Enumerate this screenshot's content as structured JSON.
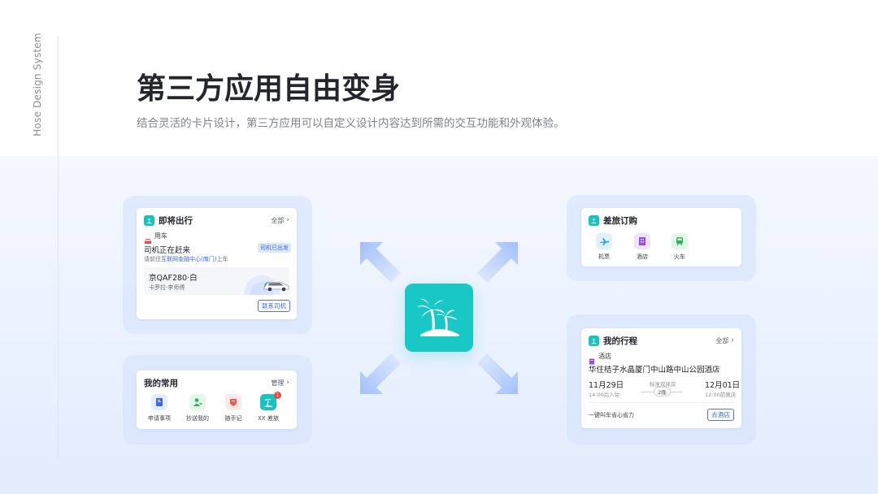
{
  "brand_vertical": "Hose Design System",
  "title": "第三方应用自由变身",
  "subtitle": "结合灵活的卡片设计，第三方应用可以自定义设计内容达到所需的交互功能和外观体验。",
  "colors": {
    "accent": "#17c2c0",
    "primary_blue": "#3a64f0",
    "badge_bg": "#dbe8ff",
    "badge_text": "#3f6cf0"
  },
  "trip_card": {
    "title": "即将出行",
    "more": "全部",
    "section": "用车",
    "status": "司机正在赶来",
    "badge": "司机已出发",
    "pickup_prefix": "请前往",
    "pickup_place": "互联网金融中心(南门)",
    "pickup_suffix": "上车",
    "plate": "京QAF280·白",
    "driver": "卡罗拉·李师傅",
    "contact_button": "联系司机"
  },
  "favorites_card": {
    "title": "我的常用",
    "more": "管理",
    "items": [
      {
        "label": "申请事项",
        "icon": "document-icon"
      },
      {
        "label": "抄送我的",
        "icon": "user-forward-icon"
      },
      {
        "label": "随手记",
        "icon": "note-icon"
      },
      {
        "label": "XX 差旅",
        "icon": "palm-tree-icon"
      }
    ],
    "notification_count": "1"
  },
  "booking_card": {
    "title": "差旅订购",
    "items": [
      {
        "label": "机票",
        "icon": "plane-icon"
      },
      {
        "label": "酒店",
        "icon": "hotel-icon"
      },
      {
        "label": "火车",
        "icon": "train-icon"
      }
    ]
  },
  "itinerary_card": {
    "title": "我的行程",
    "more": "全部",
    "section": "酒店",
    "hotel_name": "华住桔子水晶厦门中山路中山公园酒店",
    "checkin_date": "11月29日",
    "checkin_note": "14:00后入住",
    "room_type": "标准双床房",
    "nights": "2晚",
    "checkout_date": "12月01日",
    "checkout_note": "12:00前离店",
    "footer_text": "一键叫车省心省力",
    "footer_button": "去酒店"
  }
}
